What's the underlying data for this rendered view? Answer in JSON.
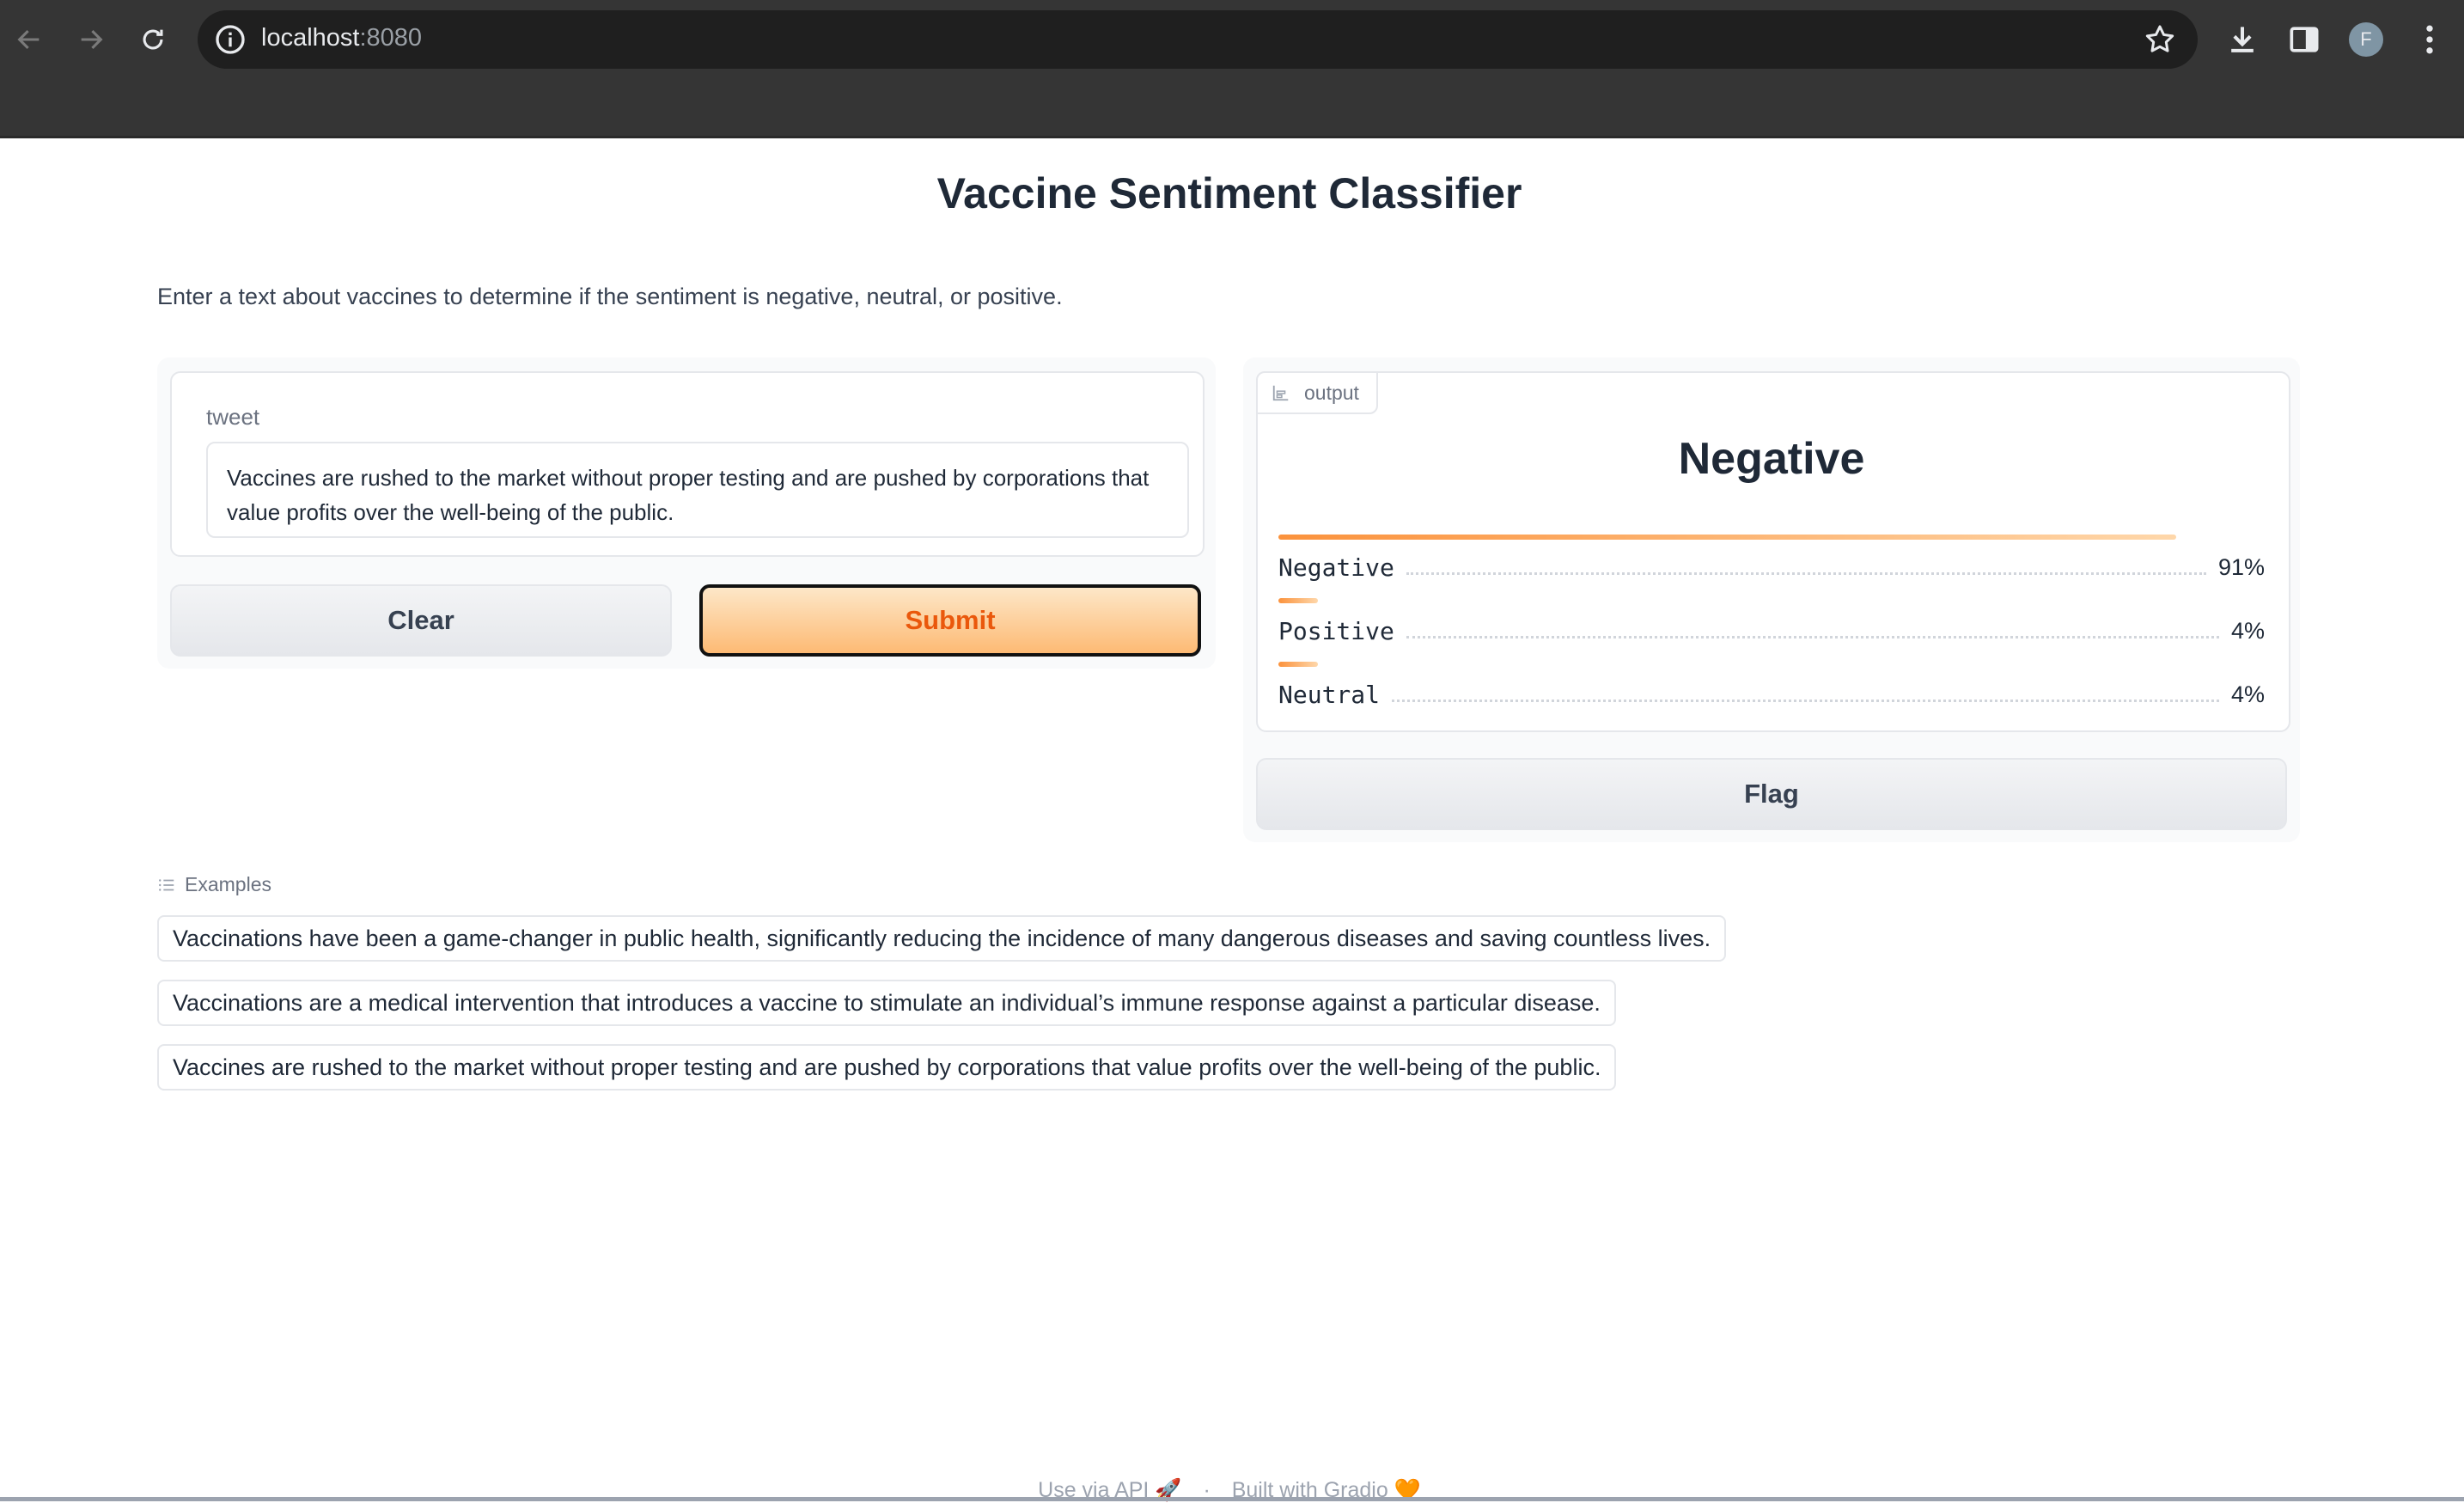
{
  "browser": {
    "url_host": "localhost",
    "url_port": ":8080",
    "avatar_letter": "F"
  },
  "app": {
    "title": "Vaccine Sentiment Classifier",
    "description": "Enter a text about vaccines to determine if the sentiment is negative, neutral, or positive."
  },
  "input": {
    "label": "tweet",
    "value": "Vaccines are rushed to the market without proper testing and are pushed by corporations that value profits over the well-being of the public."
  },
  "buttons": {
    "clear": "Clear",
    "submit": "Submit",
    "flag": "Flag"
  },
  "output": {
    "tag": "output",
    "top_label": "Negative",
    "confidences": [
      {
        "label": "Negative",
        "pct": "91%",
        "value": 0.91
      },
      {
        "label": "Positive",
        "pct": "4%",
        "value": 0.04
      },
      {
        "label": "Neutral",
        "pct": "4%",
        "value": 0.04
      }
    ]
  },
  "examples": {
    "heading": "Examples",
    "items": [
      "Vaccinations have been a game-changer in public health, significantly reducing the incidence of many dangerous diseases and saving countless lives.",
      "Vaccinations are a medical intervention that introduces a vaccine to stimulate an individual’s immune response against a particular disease.",
      "Vaccines are rushed to the market without proper testing and are pushed by corporations that value profits over the well-being of the public."
    ]
  },
  "footer": {
    "api": "Use via API",
    "separator": "·",
    "built": "Built with Gradio"
  },
  "colors": {
    "accent": "#ea580c",
    "bar_start": "#fb923c",
    "bar_end": "#fed7aa",
    "chrome": "#353535"
  }
}
